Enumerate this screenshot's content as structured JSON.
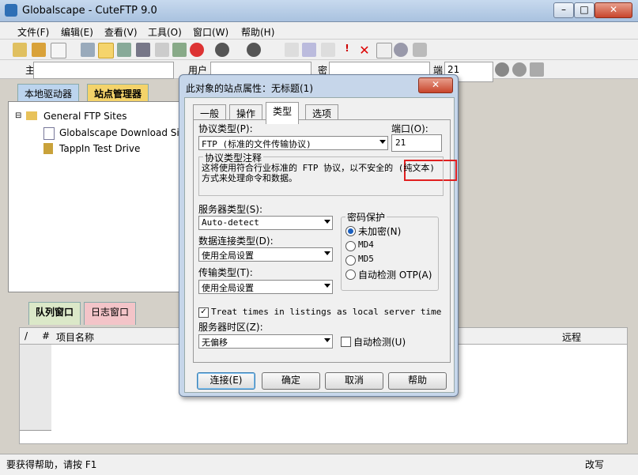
{
  "window": {
    "title": "Globalscape - CuteFTP 9.0"
  },
  "menu": [
    "文件(F)",
    "编辑(E)",
    "查看(V)",
    "工具(O)",
    "窗口(W)",
    "帮助(H)"
  ],
  "quickconnect": {
    "host_label": "主",
    "user_label": "用户",
    "pass_label": "密",
    "port_label": "端",
    "port_value": "21"
  },
  "left_tabs": [
    "本地驱动器",
    "站点管理器"
  ],
  "tree": {
    "root": "General FTP Sites",
    "items": [
      "Globalscape Download Sit",
      "TappIn Test Drive"
    ]
  },
  "queue_tabs": [
    "队列窗口",
    "日志窗口"
  ],
  "queue_columns": {
    "slash": "/",
    "num": "#",
    "name": "项目名称",
    "remote": "远程"
  },
  "status": {
    "help": "要获得帮助，请按 F1",
    "mode": "改写"
  },
  "dialog": {
    "title": "此对象的站点属性：无标题(1)",
    "tabs": [
      "一般",
      "操作",
      "类型",
      "选项"
    ],
    "protocol_label": "协议类型(P):",
    "protocol_value": "FTP (标准的文件传输协议)",
    "port_label": "端口(O):",
    "port_value": "21",
    "note_title": "协议类型注释",
    "note_text": "这将使用符合行业标准的 FTP 协议，以不安全的 (纯文本) 方式来处理命令和数据。",
    "server_type_label": "服务器类型(S):",
    "server_type_value": "Auto-detect",
    "data_conn_label": "数据连接类型(D):",
    "data_conn_value": "使用全局设置",
    "transfer_label": "传输类型(T):",
    "transfer_value": "使用全局设置",
    "pw_group": "密码保护",
    "pw_options": [
      "未加密(N)",
      "MD4",
      "MD5",
      "自动检测 OTP(A)"
    ],
    "treat_label": "Treat times in listings as local server time",
    "tz_label": "服务器时区(Z):",
    "tz_value": "无偏移",
    "auto_detect_label": "自动检测(U)",
    "buttons": {
      "connect": "连接(E)",
      "ok": "确定",
      "cancel": "取消",
      "help": "帮助"
    }
  },
  "colors": {
    "accent_tab": "#f4d36a",
    "highlight": "#e02020",
    "selected_radio": "#1a5fbf"
  }
}
